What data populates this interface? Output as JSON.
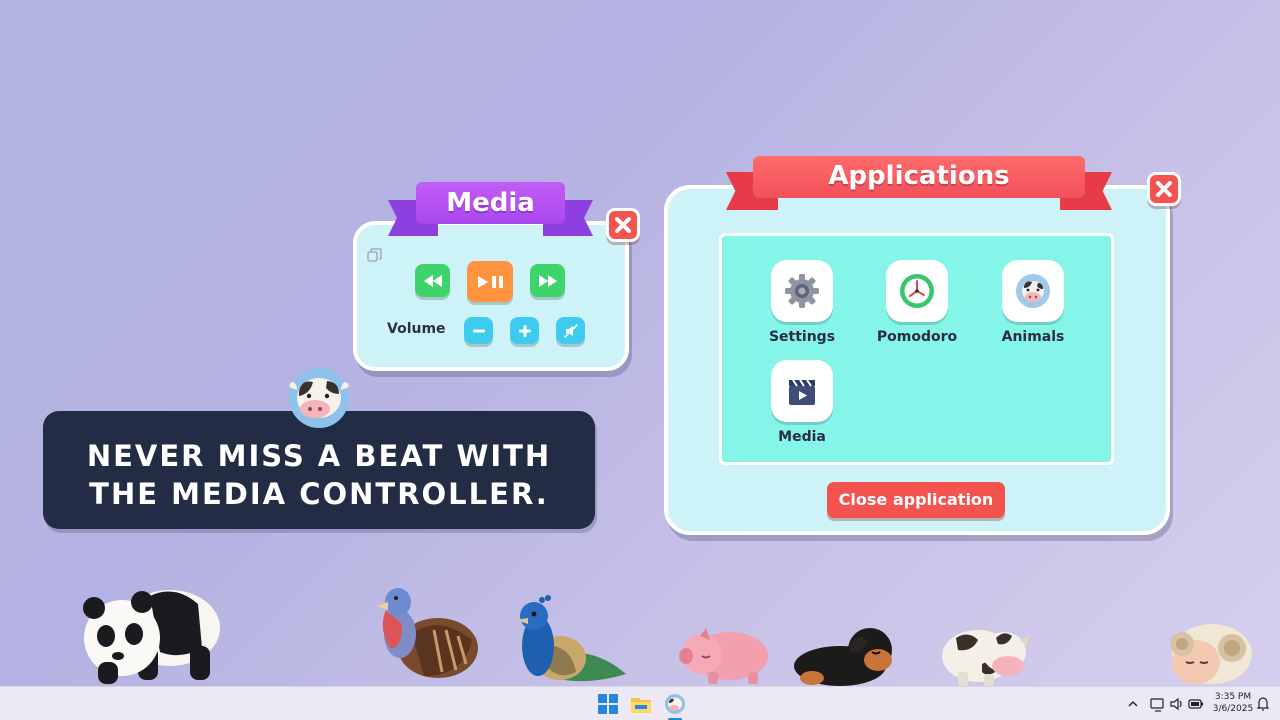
{
  "media": {
    "title": "Media",
    "volume_label": "Volume",
    "buttons": [
      "rewind-icon",
      "play-pause-icon",
      "fast-forward-icon",
      "volume-down-icon",
      "volume-up-icon",
      "mute-icon"
    ]
  },
  "applications": {
    "title": "Applications",
    "apps": [
      {
        "label": "Settings",
        "icon": "gear-icon"
      },
      {
        "label": "Pomodoro",
        "icon": "clock-icon"
      },
      {
        "label": "Animals",
        "icon": "cow-icon"
      },
      {
        "label": "Media",
        "icon": "clapperboard-icon"
      }
    ],
    "close_label": "Close application"
  },
  "caption": {
    "line1": "NEVER MISS A BEAT WITH",
    "line2": "THE MEDIA CONTROLLER."
  },
  "taskbar": {
    "time": "3:35 PM",
    "date": "3/6/2025"
  },
  "colors": {
    "media_ribbon": "#b652f2",
    "apps_ribbon": "#f2505a",
    "panel_bg": "#cdf3f8",
    "grid_bg": "#84f5e6",
    "close_red": "#f4534f",
    "caption_bg": "#222c44"
  }
}
